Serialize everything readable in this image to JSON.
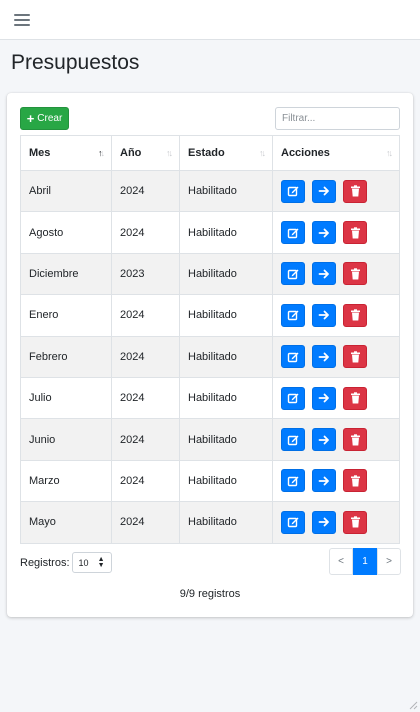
{
  "header": {
    "menu_icon": "hamburger-icon"
  },
  "page": {
    "title": "Presupuestos"
  },
  "toolbar": {
    "create_label": "Crear",
    "filter_placeholder": "Filtrar..."
  },
  "table": {
    "columns": [
      "Mes",
      "Año",
      "Estado",
      "Acciones"
    ],
    "sort": {
      "column": "Mes",
      "direction": "asc"
    },
    "rows": [
      {
        "mes": "Abril",
        "anio": "2024",
        "estado": "Habilitado"
      },
      {
        "mes": "Agosto",
        "anio": "2024",
        "estado": "Habilitado"
      },
      {
        "mes": "Diciembre",
        "anio": "2023",
        "estado": "Habilitado"
      },
      {
        "mes": "Enero",
        "anio": "2024",
        "estado": "Habilitado"
      },
      {
        "mes": "Febrero",
        "anio": "2024",
        "estado": "Habilitado"
      },
      {
        "mes": "Julio",
        "anio": "2024",
        "estado": "Habilitado"
      },
      {
        "mes": "Junio",
        "anio": "2024",
        "estado": "Habilitado"
      },
      {
        "mes": "Marzo",
        "anio": "2024",
        "estado": "Habilitado"
      },
      {
        "mes": "Mayo",
        "anio": "2024",
        "estado": "Habilitado"
      }
    ],
    "action_icons": [
      "edit-icon",
      "arrow-right-icon",
      "trash-icon"
    ]
  },
  "footer": {
    "registros_label": "Registros:",
    "page_size": "10",
    "pagination": {
      "prev": "<",
      "current": "1",
      "next": ">"
    },
    "count_text": "9/9 registros"
  },
  "colors": {
    "primary": "#007bff",
    "success": "#28a745",
    "danger": "#dc3545",
    "stripe": "#f2f2f2"
  }
}
